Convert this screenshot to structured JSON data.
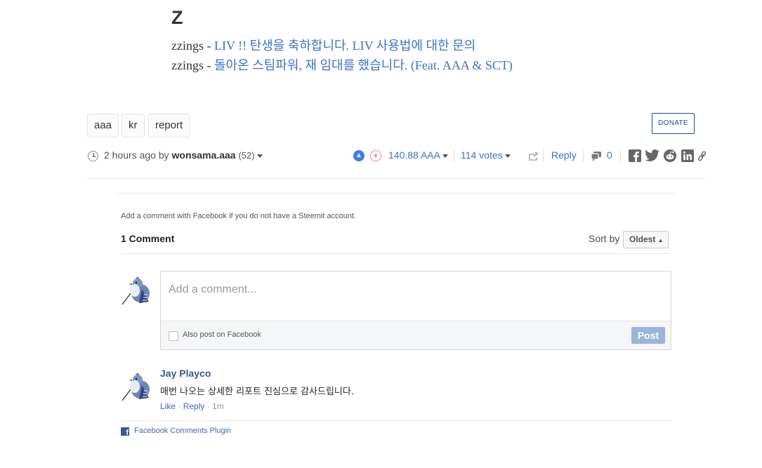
{
  "article": {
    "heading": "Z",
    "lines": [
      {
        "author": "zzings -",
        "link": "LIV !! 탄생을 축하합니다. LIV 사용법에 대한 문의"
      },
      {
        "author": "zzings -",
        "link": "돌아온 스팀파워, 재 임대를 했습니다. (Feat. AAA & SCT)"
      }
    ]
  },
  "tags": [
    "aaa",
    "kr",
    "report"
  ],
  "donate_label": "DONATE",
  "meta": {
    "time": "2 hours ago by",
    "author": "wonsama.aaa",
    "reputation": "(52)",
    "payout": "140.88 AAA",
    "votes": "114 votes",
    "reply": "Reply",
    "comment_count": "0"
  },
  "social_icons": [
    "facebook-icon",
    "twitter-icon",
    "reddit-icon",
    "linkedin-icon",
    "link-icon"
  ],
  "fb": {
    "notice": "Add a comment with Facebook if you do not have a Steemit account.",
    "count_label": "1 Comment",
    "sort_label": "Sort by",
    "sort_value": "Oldest",
    "placeholder": "Add a comment...",
    "also_post": "Also post on Facebook",
    "post_label": "Post",
    "comment": {
      "name": "Jay Playco",
      "text": "매번 나오는 상세한 리포트 진심으로 감사드립니다.",
      "like": "Like",
      "reply": "Reply",
      "time": "1m"
    },
    "plugin_label": "Facebook Comments Plugin"
  }
}
